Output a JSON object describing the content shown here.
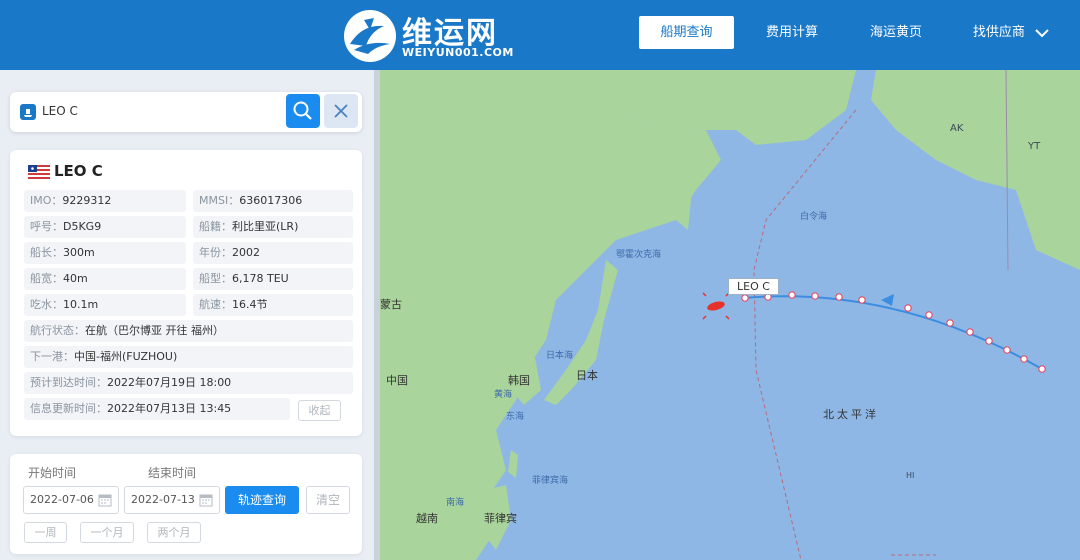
{
  "header": {
    "logo_cn": "维运网",
    "logo_en": "WEIYUN001.COM",
    "nav": [
      {
        "label": "船期查询",
        "active": true
      },
      {
        "label": "费用计算",
        "active": false
      },
      {
        "label": "海运黄页",
        "active": false
      },
      {
        "label": "找供应商",
        "active": false
      }
    ]
  },
  "search": {
    "value": "LEO C"
  },
  "ship": {
    "name": "LEO C",
    "fields": [
      {
        "label": "IMO：",
        "value": "9229312"
      },
      {
        "label": "MMSI：",
        "value": "636017306"
      },
      {
        "label": "呼号：",
        "value": "D5KG9"
      },
      {
        "label": "船籍：",
        "value": "利比里亚(LR)"
      },
      {
        "label": "船长：",
        "value": "300m"
      },
      {
        "label": "年份：",
        "value": "2002"
      },
      {
        "label": "船宽：",
        "value": "40m"
      },
      {
        "label": "船型：",
        "value": "6,178 TEU"
      },
      {
        "label": "吃水：",
        "value": "10.1m"
      },
      {
        "label": "航速：",
        "value": "16.4节"
      }
    ],
    "status": {
      "label": "航行状态：",
      "value": "在航（巴尔博亚 开往 福州）"
    },
    "next_port": {
      "label": "下一港：",
      "value": "中国-福州(FUZHOU)"
    },
    "eta": {
      "label": "预计到达时间：",
      "value": "2022年07月19日 18:00"
    },
    "updated": {
      "label": "信息更新时间：",
      "value": "2022年07月13日 13:45"
    },
    "collapse_label": "收起"
  },
  "track": {
    "start_label": "开始时间",
    "end_label": "结束时间",
    "start_date": "2022-07-06",
    "end_date": "2022-07-13",
    "query_label": "轨迹查询",
    "clear_label": "清空",
    "quick": [
      "一周",
      "一个月",
      "两个月"
    ]
  },
  "map": {
    "ship_label": "LEO C",
    "labels": [
      "AK",
      "YT",
      "白令海",
      "鄂霍次克海",
      "蒙古",
      "日本海",
      "中国",
      "韩国",
      "日本",
      "黄海",
      "东海",
      "北太平洋",
      "菲律宾海",
      "南海",
      "越南",
      "菲律宾",
      "HI"
    ],
    "colors": {
      "ocean": "#8fb7e6",
      "land": "#a9d49b",
      "track": "#3b8de0",
      "point": "#e0506a",
      "ship": "#e5322d"
    }
  }
}
